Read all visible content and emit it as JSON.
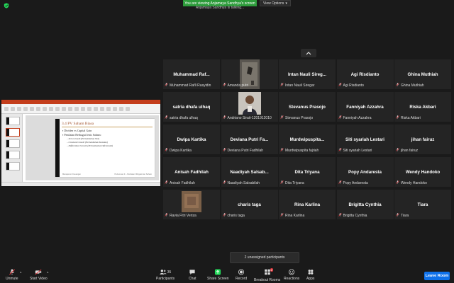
{
  "banner": {
    "text": "You are viewing Anjamaya Sandhya's screen",
    "view_options": "View Options",
    "sub": "Anjamaya Sandhya is talking..."
  },
  "share": {
    "slide_title": "3.4    PV Saham Biasa",
    "bullets": [
      "Dividen vs Capital Gain",
      "Penilaian Berbagai Jenis Saham:"
    ],
    "subbullets": [
      "Zero Growth (Pertumbuhan Nol)",
      "Constant Growth (Pertumbuhan Konstan)",
      "Differential Growth (Pertumbuhan Diferensial)"
    ],
    "footer_left": "Manajemen Keuangan",
    "footer_right": "Pertemuan 3 – Penilaian Obligasi dan Saham"
  },
  "participants": [
    {
      "tile_name": "Muhammad Raf...",
      "label": "Muhammad Rafli Rasyidin",
      "type": "name"
    },
    {
      "tile_name": "",
      "label": "Amanda putri",
      "type": "photo-doc"
    },
    {
      "tile_name": "Intan Nauli Sireg...",
      "label": "Intan Nauli Siregar",
      "type": "name"
    },
    {
      "tile_name": "Agi Risdianto",
      "label": "Agi Risdianto",
      "type": "name"
    },
    {
      "tile_name": "Ghina Muthiah",
      "label": "Ghina Muthiah",
      "type": "name"
    },
    {
      "tile_name": "satria dhafa ulhaq",
      "label": "satria dhafa ulhaq",
      "type": "name"
    },
    {
      "tile_name": "",
      "label": "Andriano Sirait-1201912010",
      "type": "photo-person"
    },
    {
      "tile_name": "Stevanus Prasojo",
      "label": "Stevanus Prasojo",
      "type": "name"
    },
    {
      "tile_name": "Fanniyah Azzahra",
      "label": "Fanniyah Azzahra",
      "type": "name"
    },
    {
      "tile_name": "Riska Akbari",
      "label": "Riska Akbari",
      "type": "name"
    },
    {
      "tile_name": "Dwipa Kartika",
      "label": "Dwipa Kartika",
      "type": "name"
    },
    {
      "tile_name": "Deviana Putri Fa...",
      "label": "Deviana Putri Fadhilah",
      "type": "name"
    },
    {
      "tile_name": "Murdwipuspita...",
      "label": "Murdwipuspita fajriah",
      "type": "name"
    },
    {
      "tile_name": "Siti syariah Lestari",
      "label": "Siti syariah Lestari",
      "type": "name"
    },
    {
      "tile_name": "jihan fairuz",
      "label": "jihan fairuz",
      "type": "name"
    },
    {
      "tile_name": "Anisah Fadhilah",
      "label": "Anisah Fadhilah",
      "type": "name"
    },
    {
      "tile_name": "Naadiyah Salsab...",
      "label": "Naadiyah Salsabilah",
      "type": "name"
    },
    {
      "tile_name": "Dita Triyana",
      "label": "Dita Triyana",
      "type": "name"
    },
    {
      "tile_name": "Popy Andaresta",
      "label": "Popy Andaresta",
      "type": "name"
    },
    {
      "tile_name": "Wendy Handoko",
      "label": "Wendy Handoko",
      "type": "name"
    },
    {
      "tile_name": "",
      "label": "Ravia Fitri Veriza",
      "type": "photo-blur"
    },
    {
      "tile_name": "charis taga",
      "label": "charis taga",
      "type": "name"
    },
    {
      "tile_name": "Rina Karlina",
      "label": "Rina Karlina",
      "type": "name"
    },
    {
      "tile_name": "Brigitta Cynthia",
      "label": "Brigitta Cynthia",
      "type": "name"
    },
    {
      "tile_name": "Tiara",
      "label": "Tiara",
      "type": "name"
    }
  ],
  "unassigned": "2 unassigned participants",
  "toolbar": {
    "unmute": "Unmute",
    "start_video": "Start Video",
    "participants": "Participants",
    "participant_count": "35",
    "chat": "Chat",
    "share_screen": "Share Screen",
    "record": "Record",
    "breakout_rooms": "Breakout Rooms",
    "breakout_badge": "2",
    "reactions": "Reactions",
    "apps": "Apps",
    "leave": "Leave Room"
  },
  "colors": {
    "banner_green": "#2c9b3a",
    "share_green": "#23d959",
    "muted_red": "#e0393e",
    "leave_blue": "#0e71eb"
  }
}
